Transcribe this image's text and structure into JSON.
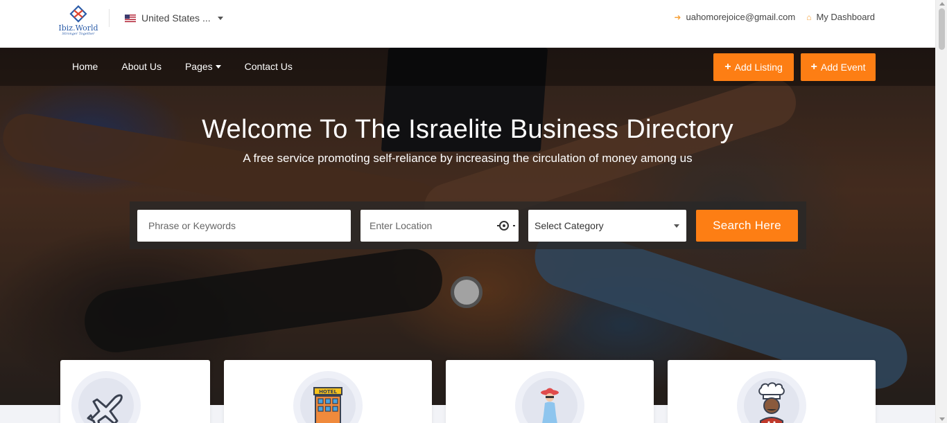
{
  "header": {
    "logo": {
      "name": "Ibiz.World",
      "tagline": "Stronger Together"
    },
    "country": "United States ...",
    "email": "uahomorejoice@gmail.com",
    "dashboard": "My Dashboard"
  },
  "nav": {
    "items": [
      {
        "label": "Home"
      },
      {
        "label": "About Us"
      },
      {
        "label": "Pages"
      },
      {
        "label": "Contact Us"
      }
    ],
    "add_listing": "Add Listing",
    "add_event": "Add Event"
  },
  "hero": {
    "title": "Welcome To The Israelite Business Directory",
    "subtitle": "A free service promoting self-reliance by increasing the circulation of money among us"
  },
  "search": {
    "keywords_placeholder": "Phrase or Keywords",
    "location_placeholder": "Enter Location",
    "category_selected": "Select Category",
    "button": "Search Here"
  },
  "categories": [
    {
      "icon": "airplane-icon"
    },
    {
      "icon": "hotel-icon",
      "label": "HOTEL"
    },
    {
      "icon": "woman-fashion-icon"
    },
    {
      "icon": "chef-icon"
    }
  ],
  "colors": {
    "accent": "#fd7e14",
    "link_icon": "#f7a23a"
  }
}
